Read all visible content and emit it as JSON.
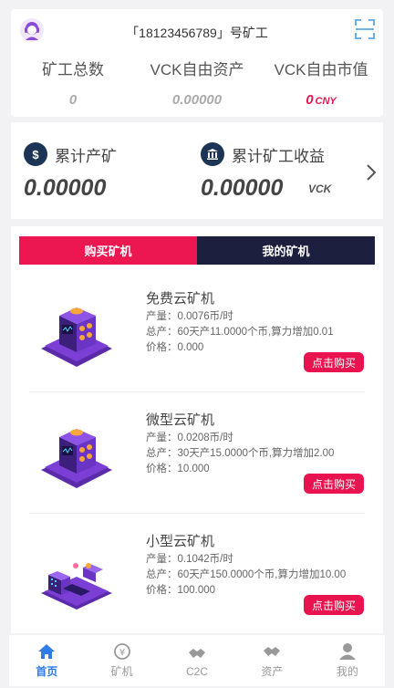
{
  "header": {
    "title": "「18123456789」号矿工"
  },
  "stats": [
    {
      "label": "矿工总数",
      "value": "0",
      "unit": ""
    },
    {
      "label": "VCK自由资产",
      "value": "0.00000",
      "unit": ""
    },
    {
      "label": "VCK自由市值",
      "value": "0",
      "unit": "CNY"
    }
  ],
  "earnings": {
    "mined_label": "累计产矿",
    "mined_value": "0.00000",
    "income_label": "累计矿工收益",
    "income_value": "0.00000",
    "unit": "VCK"
  },
  "tabs": [
    {
      "label": "购买矿机"
    },
    {
      "label": "我的矿机"
    }
  ],
  "machines": [
    {
      "name": "免费云矿机",
      "output": "产量：0.0076币/时",
      "total": "总产：60天产11.0000个币,算力增加0.01",
      "price": "价格：0.000",
      "button": "点击购买"
    },
    {
      "name": "微型云矿机",
      "output": "产量：0.0208币/时",
      "total": "总产：30天产15.0000个币,算力增加2.00",
      "price": "价格：10.000",
      "button": "点击购买"
    },
    {
      "name": "小型云矿机",
      "output": "产量：0.1042币/时",
      "total": "总产：60天产150.0000个币,算力增加10.00",
      "price": "价格：100.000",
      "button": "点击购买"
    }
  ],
  "nav": [
    {
      "label": "首页",
      "icon": "home-icon",
      "active": true
    },
    {
      "label": "矿机",
      "icon": "coin-icon",
      "active": false
    },
    {
      "label": "C2C",
      "icon": "handshake-icon",
      "active": false
    },
    {
      "label": "资产",
      "icon": "handshake-icon",
      "active": false
    },
    {
      "label": "我的",
      "icon": "user-icon",
      "active": false
    }
  ],
  "colors": {
    "accent": "#e8134f",
    "dark": "#1c1f3d",
    "nav_active": "#2f7be8"
  }
}
